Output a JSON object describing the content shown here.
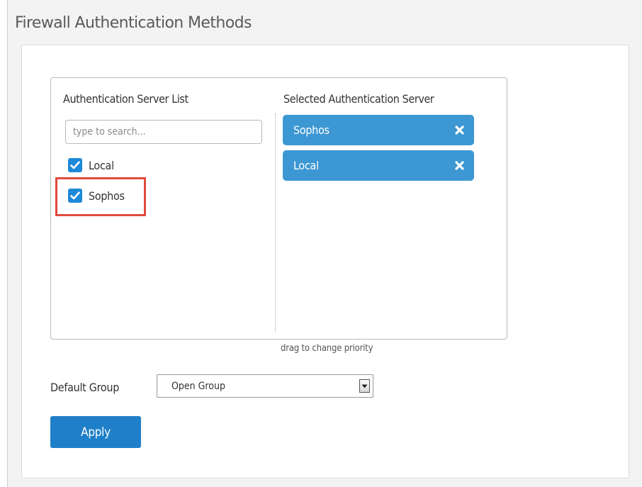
{
  "page": {
    "title": "Firewall Authentication Methods"
  },
  "server_list": {
    "title": "Authentication Server List",
    "search_placeholder": "type to search...",
    "items": [
      {
        "label": "Local",
        "checked": true
      },
      {
        "label": "Sophos",
        "checked": true
      }
    ]
  },
  "selected": {
    "title": "Selected Authentication Server",
    "items": [
      {
        "label": "Sophos"
      },
      {
        "label": "Local"
      }
    ]
  },
  "hint": "drag to change priority",
  "default_group": {
    "label": "Default Group",
    "value": "Open Group"
  },
  "apply_label": "Apply",
  "icons": {
    "checkbox": "checkmark-icon",
    "remove": "close-icon",
    "dropdown": "triangle-down-icon"
  },
  "colors": {
    "chip": "#3d97d3",
    "checkbox": "#1e88d9",
    "apply": "#1f7fc9",
    "highlight": "#e04a3f"
  }
}
